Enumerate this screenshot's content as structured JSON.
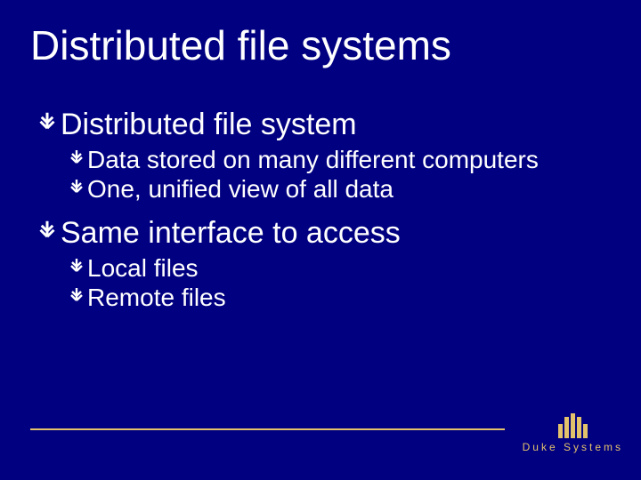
{
  "title": "Distributed file systems",
  "bullets": {
    "p1": {
      "text": "Distributed file system"
    },
    "p1c1": {
      "text": "Data stored on many different computers"
    },
    "p1c2": {
      "text": "One, unified view of all data"
    },
    "p2": {
      "text": "Same interface to access"
    },
    "p2c1": {
      "text": "Local files"
    },
    "p2c2": {
      "text": "Remote files"
    }
  },
  "footer": {
    "brand": "Duke Systems"
  },
  "colors": {
    "bg": "#000080",
    "accent": "#e3c26c",
    "text": "#ffffff"
  }
}
